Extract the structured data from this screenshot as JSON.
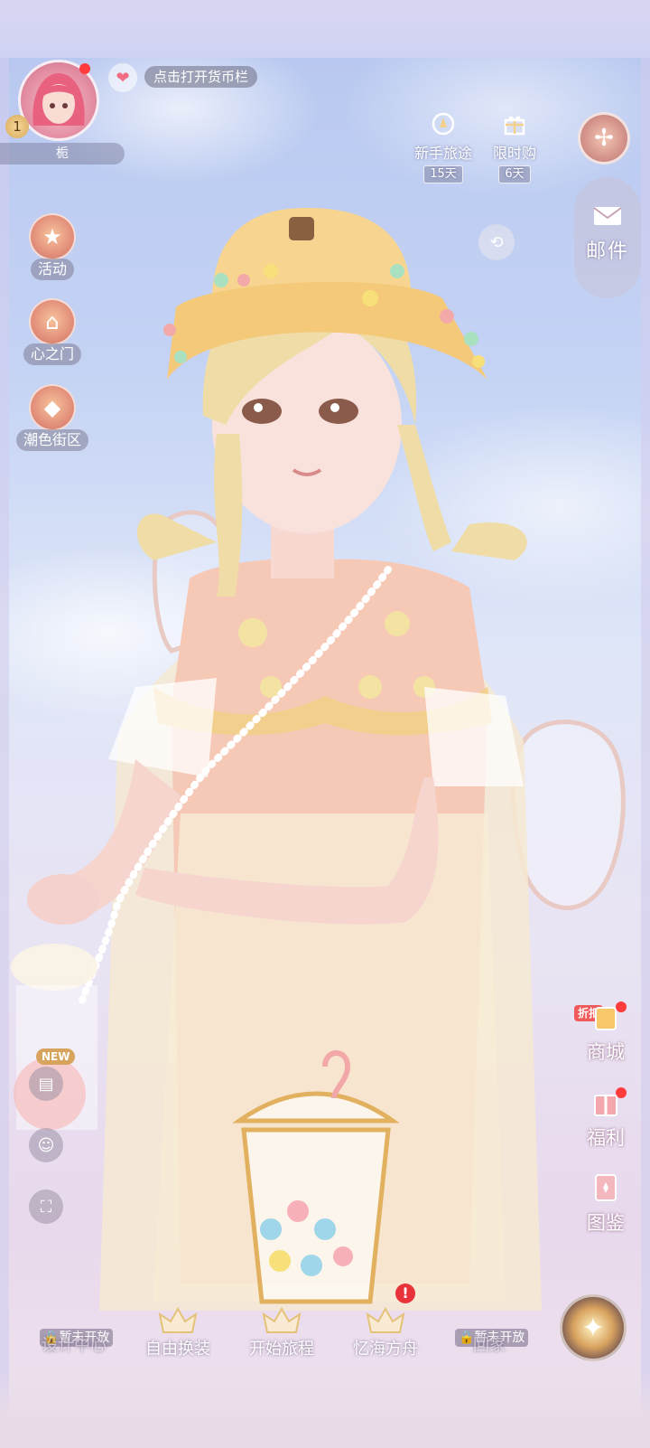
{
  "player": {
    "name": "栀",
    "level": "1",
    "currency_prompt": "点击打开货币栏"
  },
  "events": {
    "novice_journey": {
      "label": "新手旅途",
      "days": "15天"
    },
    "limited_shop": {
      "label": "限时购",
      "days": "6天"
    }
  },
  "right_panel": {
    "mail_label": "邮件"
  },
  "left_menu": [
    {
      "label": "活动"
    },
    {
      "label": "心之门"
    },
    {
      "label": "潮色街区"
    }
  ],
  "left_tools": {
    "new_badge": "NEW"
  },
  "right_menu": {
    "discount_badge": "折扣",
    "shop": "商城",
    "welfare": "福利",
    "gallery": "图鉴"
  },
  "bottom_nav": [
    {
      "label": "设计中心",
      "locked_text": "暂未开放"
    },
    {
      "label": "自由换装"
    },
    {
      "label": "开始旅程"
    },
    {
      "label": "忆海方舟",
      "alert": "!"
    },
    {
      "label": "回家",
      "locked_text": "暂未开放"
    }
  ],
  "colors": {
    "accent_red": "#ff3b3b",
    "sky_blue": "#b7c6ef",
    "gold": "#d8a35c"
  }
}
